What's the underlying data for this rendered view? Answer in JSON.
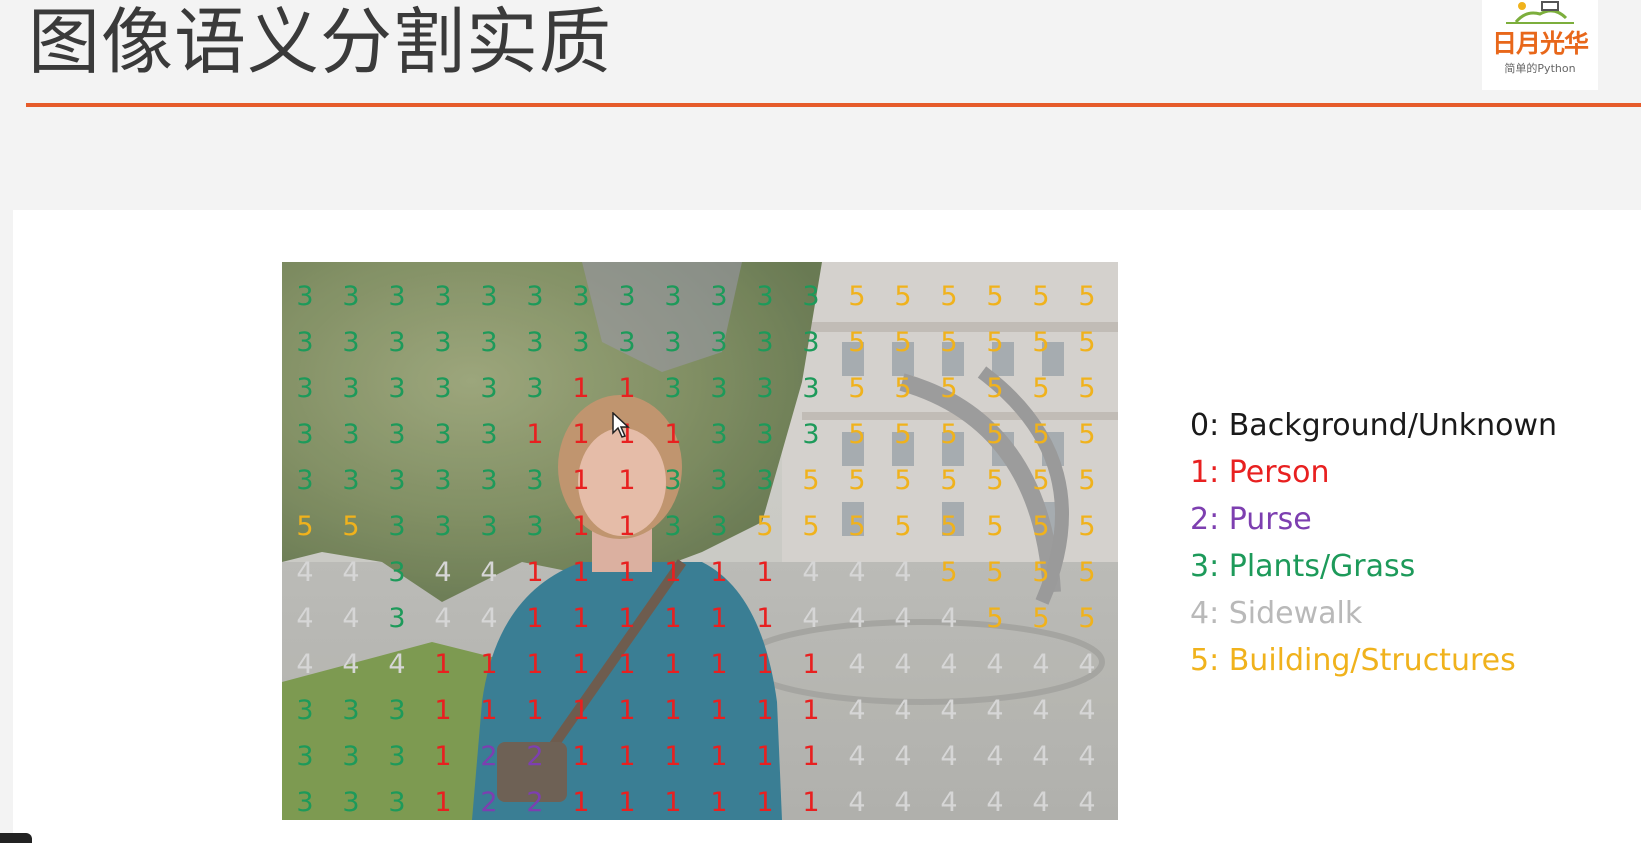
{
  "slide": {
    "title": "图像语义分割实质"
  },
  "logo": {
    "main": "日月光华",
    "sub": "简单的Python"
  },
  "legend": [
    {
      "text": "0: Background/Unknown",
      "color": "#1a1a1a"
    },
    {
      "text": "1: Person",
      "color": "#e82020"
    },
    {
      "text": "2: Purse",
      "color": "#7d3fb0"
    },
    {
      "text": "3: Plants/Grass",
      "color": "#1d9a5a"
    },
    {
      "text": "4: Sidewalk",
      "color": "#b9b9b9"
    },
    {
      "text": "5: Building/Structures",
      "color": "#f0b21c"
    }
  ],
  "label_colors": {
    "1": "#e82020",
    "2": "#7d3fb0",
    "3": "#1d9a5a",
    "4": "#d6d6d6",
    "5": "#f0b21c"
  },
  "segmentation_grid": [
    "333333333333555555",
    "333333333333555555",
    "333333113333555555",
    "333331111333555555",
    "333333113335555555",
    "553333113355555555",
    "443441111114445555",
    "443441111114444555",
    "444111111111444444",
    "333111111111444444",
    "333122111111444444",
    "333122111111444444"
  ]
}
